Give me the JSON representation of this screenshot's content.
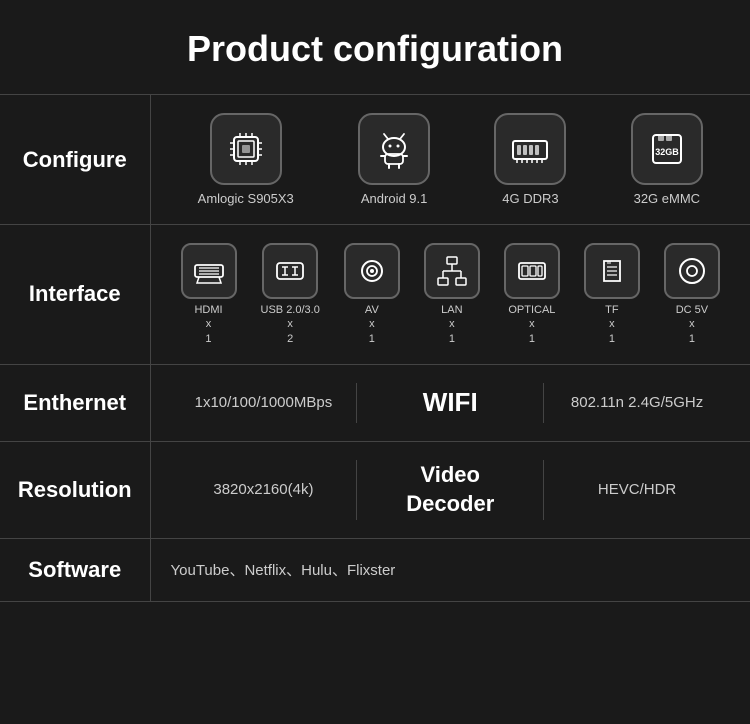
{
  "page": {
    "title": "Product configuration"
  },
  "configure": {
    "label": "Configure",
    "items": [
      {
        "name": "Amlogic S905X3",
        "icon": "chip"
      },
      {
        "name": "Android 9.1",
        "icon": "android"
      },
      {
        "name": "4G DDR3",
        "icon": "ram"
      },
      {
        "name": "32G eMMC",
        "icon": "emmc"
      }
    ]
  },
  "interface": {
    "label": "Interface",
    "items": [
      {
        "name": "HDMI",
        "count": "x\n1",
        "icon": "hdmi"
      },
      {
        "name": "USB 2.0/3.0",
        "count": "x\n2",
        "icon": "usb"
      },
      {
        "name": "AV",
        "count": "x\n1",
        "icon": "av"
      },
      {
        "name": "LAN",
        "count": "x\n1",
        "icon": "lan"
      },
      {
        "name": "OPTICAL",
        "count": "x\n1",
        "icon": "optical"
      },
      {
        "name": "TF",
        "count": "x\n1",
        "icon": "tf"
      },
      {
        "name": "DC 5V",
        "count": "x\n1",
        "icon": "dc"
      }
    ]
  },
  "ethernet": {
    "label": "Enthernet",
    "speed": "1x10/100/1000MBps",
    "wifi_label": "WIFI",
    "wifi_spec": "802.11n 2.4G/5GHz"
  },
  "resolution": {
    "label": "Resolution",
    "value": "3820x2160(4k)",
    "decoder_label": "Video\nDecoder",
    "decoder_value": "HEVC/HDR"
  },
  "software": {
    "label": "Software",
    "apps": "YouTube、Netflix、Hulu、Flixster"
  }
}
